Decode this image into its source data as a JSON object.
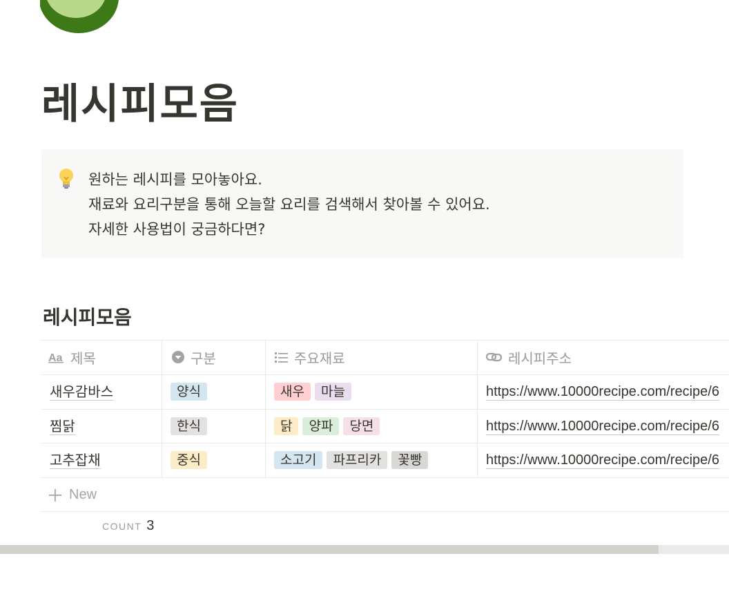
{
  "page": {
    "title": "레시피모음"
  },
  "callout": {
    "icon": "lightbulb-icon",
    "lines": [
      "원하는 레시피를 모아놓아요.",
      "재료와 요리구분을 통해 오늘할 요리를 검색해서 찾아볼 수 있어요.",
      "자세한 사용법이 궁금하다면?"
    ]
  },
  "database": {
    "title": "레시피모음",
    "columns": [
      {
        "label": "제목",
        "icon": "text-aa-icon"
      },
      {
        "label": "구분",
        "icon": "select-circle-icon"
      },
      {
        "label": "주요재료",
        "icon": "list-icon"
      },
      {
        "label": "레시피주소",
        "icon": "link-icon"
      }
    ],
    "rows": [
      {
        "title": "새우감바스",
        "category": {
          "label": "양식",
          "color": "#d3e5ef"
        },
        "ingredients": [
          {
            "label": "새우",
            "color": "#ffcfd1"
          },
          {
            "label": "마늘",
            "color": "#e8deee"
          }
        ],
        "url": "https://www.10000recipe.com/recipe/6"
      },
      {
        "title": "찜닭",
        "category": {
          "label": "한식",
          "color": "#e3e2e0"
        },
        "ingredients": [
          {
            "label": "닭",
            "color": "#fdecc8"
          },
          {
            "label": "양파",
            "color": "#dbeddb"
          },
          {
            "label": "당면",
            "color": "#f5e0e9"
          }
        ],
        "url": "https://www.10000recipe.com/recipe/6"
      },
      {
        "title": "고추잡채",
        "category": {
          "label": "중식",
          "color": "#fdecc8"
        },
        "ingredients": [
          {
            "label": "소고기",
            "color": "#d3e5ef"
          },
          {
            "label": "파프리카",
            "color": "#e3e2e0"
          },
          {
            "label": "꽃빵",
            "color": "#d9d8d5"
          }
        ],
        "url": "https://www.10000recipe.com/recipe/6"
      }
    ],
    "new_label": "New",
    "count_label": "COUNT",
    "count_value": "3"
  }
}
